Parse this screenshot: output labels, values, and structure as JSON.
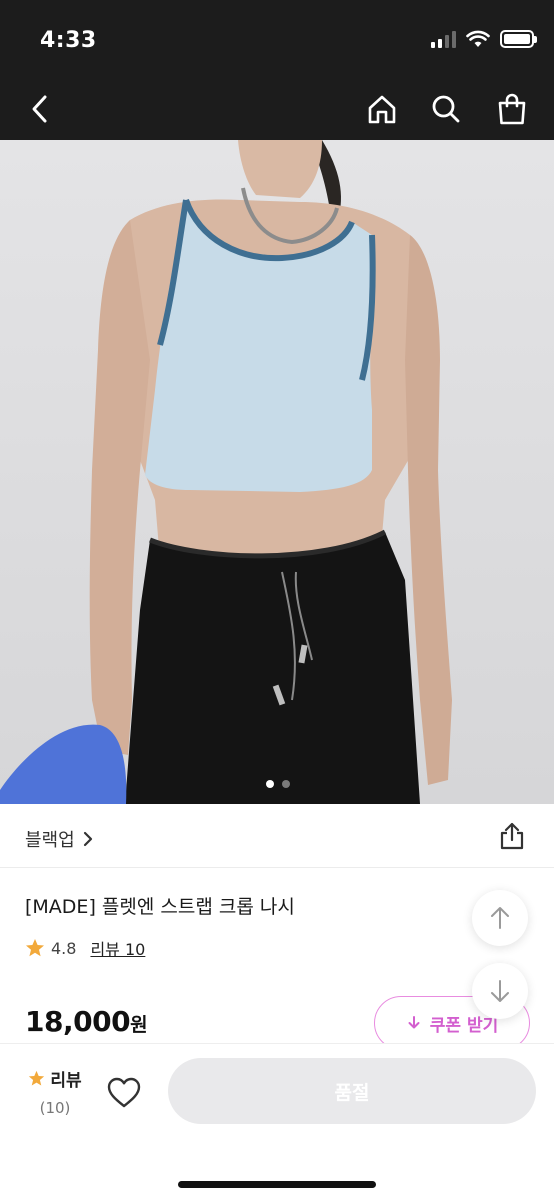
{
  "status_bar": {
    "time": "4:33"
  },
  "navigation": {
    "back_icon": "chevron-left-icon",
    "home_icon": "home-icon",
    "search_icon": "search-icon",
    "bag_icon": "shopping-bag-icon"
  },
  "image": {
    "carousel_page": 1,
    "carousel_total": 2
  },
  "product": {
    "brand": "블랙업",
    "title": "[MADE] 플렛엔 스트랩 크롭 나시",
    "rating": "4.8",
    "review_link": "리뷰 10",
    "price": "18,000",
    "price_unit": "원",
    "coupon_label": "쿠폰 받기"
  },
  "bottom_bar": {
    "review_label": "리뷰",
    "review_count": "(10)",
    "cta_label": "품절"
  },
  "colors": {
    "accent_pink": "#d35fcf",
    "star": "#f2a93b",
    "dark_bar": "#1c1c1c",
    "disabled_button": "#e9e9eb"
  }
}
